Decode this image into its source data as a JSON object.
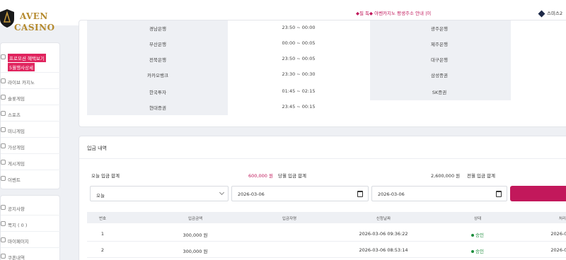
{
  "brand": {
    "line1": "AVEN",
    "line2": "CASINO"
  },
  "ticker": "◆필 독◆ 아벤카지노 평생주소 안내 |이",
  "user": {
    "name": "스미스2"
  },
  "sidebar": {
    "promo": {
      "line1": "프로모션 혜택보기",
      "line2": "5월행사상세"
    },
    "items": [
      {
        "label": "라이브 카지노",
        "icon": "dice-icon"
      },
      {
        "label": "슬롯게임",
        "icon": "slot-icon"
      },
      {
        "label": "스포츠",
        "icon": "ball-icon"
      },
      {
        "label": "미니게임",
        "icon": "game-icon"
      },
      {
        "label": "가상게임",
        "icon": "vr-icon"
      },
      {
        "label": "게시게임",
        "icon": "board-icon"
      },
      {
        "label": "이벤트",
        "icon": "gift-icon"
      }
    ],
    "items2": [
      {
        "label": "공지사항",
        "icon": "notice-icon"
      },
      {
        "label": "쪽지 ( 0 )",
        "icon": "mail-icon"
      },
      {
        "label": "마이페이지",
        "icon": "user-icon"
      },
      {
        "label": "쿠폰내역",
        "icon": "coupon-icon"
      }
    ]
  },
  "banks": {
    "left": [
      {
        "name": "경남은행",
        "time": "23:50 ~ 00:00"
      },
      {
        "name": "부산은행",
        "time": "00:00 ~ 00:05"
      },
      {
        "name": "전북은행",
        "time": "23:50 ~ 00:05"
      },
      {
        "name": "카카오뱅크",
        "time": "23:30 ~ 00:30"
      },
      {
        "name": "한국투자",
        "time": "01:45 ~ 02:15"
      },
      {
        "name": "현대증권",
        "time": "23:45 ~ 00:15"
      }
    ],
    "right": [
      "광주은행",
      "제주은행",
      "대구은행",
      "삼성증권",
      "SK증권"
    ]
  },
  "deposits": {
    "title": "입금 내역",
    "today_label": "오늘 입금 합계",
    "today_value": "600,000 원",
    "month_label": "당월 입금 합계",
    "month_value": "2,600,000 원",
    "prev_label": "전월 입금 합계",
    "filter": {
      "period": "오늘",
      "from": "2026-03-06",
      "to": "2026-03-06"
    },
    "headers": [
      "번호",
      "입금금액",
      "입금자명",
      "신청날짜",
      "상태",
      "처리날짜"
    ],
    "rows": [
      {
        "no": "1",
        "amount": "300,000 원",
        "name": "",
        "date": "2026-03-06 09:36:22",
        "status": "승인",
        "processed": "2026-03"
      },
      {
        "no": "2",
        "amount": "300,000 원",
        "name": "",
        "date": "2026-03-06 08:53:14",
        "status": "승인",
        "processed": "2026-03"
      }
    ]
  },
  "colors": {
    "accent": "#c2185b",
    "gold": "#b58a2e",
    "ok": "#1e8e3e"
  }
}
